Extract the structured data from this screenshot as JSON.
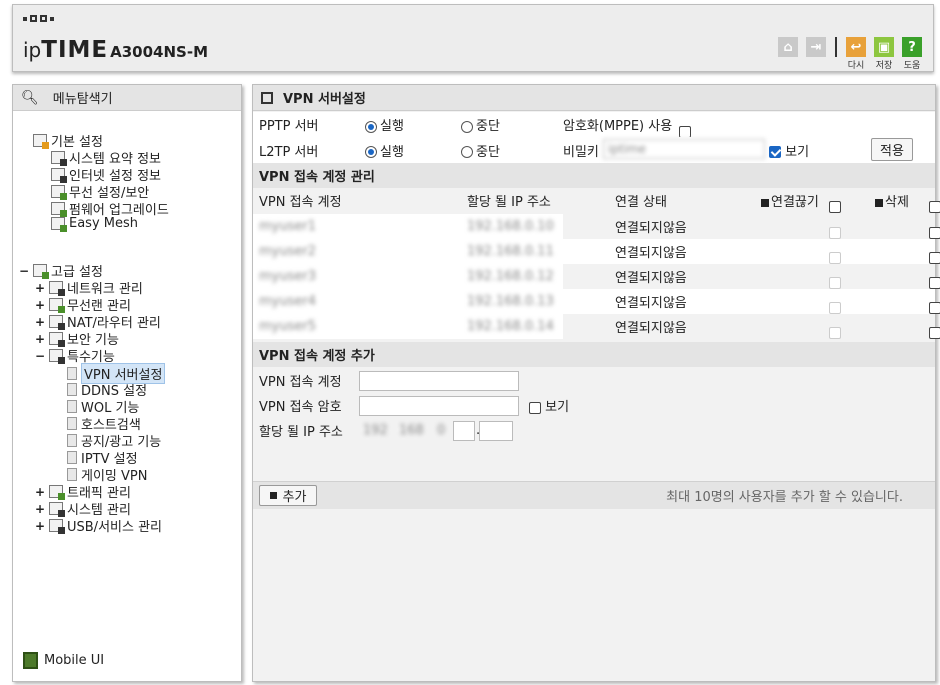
{
  "header": {
    "brand_ip": "ip",
    "brand_time": "TIME",
    "model": "A3004NS-M",
    "icons": [
      {
        "name": "home-icon",
        "label": ""
      },
      {
        "name": "logout-icon",
        "label": ""
      },
      {
        "name": "refresh-icon",
        "label": "다시"
      },
      {
        "name": "save-icon",
        "label": "저장"
      },
      {
        "name": "help-icon",
        "label": "도움"
      }
    ],
    "colors": {
      "refresh": "#e8a13a",
      "save": "#8dc63f",
      "help": "#3aa02a",
      "gray": "#c9c9c9"
    }
  },
  "nav": {
    "title": "메뉴탐색기",
    "basic": {
      "label": "기본 설정",
      "items": [
        "시스템 요약 정보",
        "인터넷 설정 정보",
        "무선 설정/보안",
        "펌웨어 업그레이드",
        "Easy Mesh"
      ]
    },
    "advanced": {
      "label": "고급 설정",
      "items": [
        "네트워크 관리",
        "무선랜 관리",
        "NAT/라우터 관리",
        "보안 기능",
        "특수기능"
      ],
      "special_items": [
        "VPN 서버설정",
        "DDNS 설정",
        "WOL 기능",
        "호스트검색",
        "공지/광고 기능",
        "IPTV 설정",
        "게이밍 VPN"
      ],
      "more_items": [
        "트래픽 관리",
        "시스템 관리",
        "USB/서비스 관리"
      ]
    },
    "mobile": "Mobile UI"
  },
  "main": {
    "title": "VPN 서버설정",
    "pptp_label": "PPTP 서버",
    "l2tp_label": "L2TP 서버",
    "run": "실행",
    "stop": "중단",
    "mppe_label": "암호화(MPPE) 사용",
    "secret_label": "비밀키",
    "secret_value": "iptime",
    "show": "보기",
    "apply": "적용",
    "account_section": "VPN 접속 계정 관리",
    "col_account": "VPN 접속 계정",
    "col_ip": "할당 될 IP 주소",
    "col_status": "연결 상태",
    "col_disconnect": "연결끊기",
    "col_delete": "삭제",
    "rows": [
      {
        "account": "myuser1",
        "ip": "192.168.0.10",
        "status": "연결되지않음"
      },
      {
        "account": "myuser2",
        "ip": "192.168.0.11",
        "status": "연결되지않음"
      },
      {
        "account": "myuser3",
        "ip": "192.168.0.12",
        "status": "연결되지않음"
      },
      {
        "account": "myuser4",
        "ip": "192.168.0.13",
        "status": "연결되지않음"
      },
      {
        "account": "myuser5",
        "ip": "192.168.0.14",
        "status": "연결되지않음"
      }
    ],
    "add_section": "VPN 접속 계정 추가",
    "add_account": "VPN 접속 계정",
    "add_password": "VPN 접속 암호",
    "add_ip": "할당 될 IP 주소",
    "ip_prefix": [
      "192",
      "168",
      "0"
    ],
    "add_button": "추가",
    "limit_note": "최대 10명의 사용자를 추가 할 수 있습니다."
  }
}
